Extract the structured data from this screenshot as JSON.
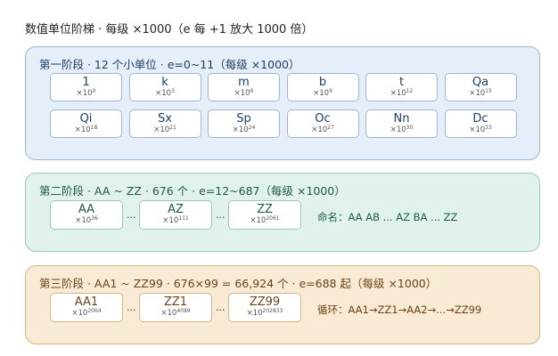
{
  "title": "数值单位阶梯 · 每级 ×1000（e 每 +1 放大 1000 倍）",
  "stage1": {
    "title": "第一阶段 · 12 个小单位 · e=0~11（每级 ×1000）",
    "units": [
      {
        "symbol": "1",
        "base": "×10",
        "exp": "0"
      },
      {
        "symbol": "k",
        "base": "×10",
        "exp": "3"
      },
      {
        "symbol": "m",
        "base": "×10",
        "exp": "6"
      },
      {
        "symbol": "b",
        "base": "×10",
        "exp": "9"
      },
      {
        "symbol": "t",
        "base": "×10",
        "exp": "12"
      },
      {
        "symbol": "Qa",
        "base": "×10",
        "exp": "15"
      },
      {
        "symbol": "Qi",
        "base": "×10",
        "exp": "18"
      },
      {
        "symbol": "Sx",
        "base": "×10",
        "exp": "21"
      },
      {
        "symbol": "Sp",
        "base": "×10",
        "exp": "24"
      },
      {
        "symbol": "Oc",
        "base": "×10",
        "exp": "27"
      },
      {
        "symbol": "Nn",
        "base": "×10",
        "exp": "30"
      },
      {
        "symbol": "Dc",
        "base": "×10",
        "exp": "33"
      }
    ]
  },
  "stage2": {
    "title": "第二阶段 · AA ~ ZZ · 676 个 · e=12~687（每级 ×1000）",
    "units": [
      {
        "symbol": "AA",
        "base": "×10",
        "exp": "36"
      },
      {
        "symbol": "AZ",
        "base": "×10",
        "exp": "111"
      },
      {
        "symbol": "ZZ",
        "base": "×10",
        "exp": "2061"
      }
    ],
    "ellipsis": "...",
    "note": "命名：AA AB ... AZ BA ... ZZ"
  },
  "stage3": {
    "title": "第三阶段 · AA1 ~ ZZ99 · 676×99 = 66,924 个 · e=688 起（每级 ×1000）",
    "units": [
      {
        "symbol": "AA1",
        "base": "×10",
        "exp": "2064"
      },
      {
        "symbol": "ZZ1",
        "base": "×10",
        "exp": "4089"
      },
      {
        "symbol": "ZZ99",
        "base": "×10",
        "exp": "202833"
      }
    ],
    "ellipsis": "...",
    "note": "循环：AA1→ZZ1→AA2→...→ZZ99"
  }
}
